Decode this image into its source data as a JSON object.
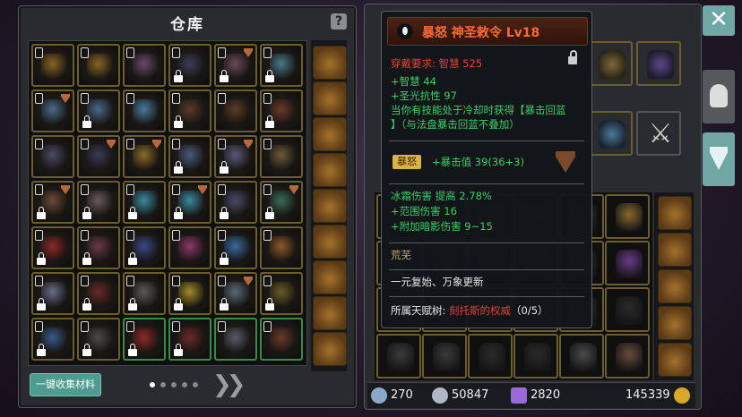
{
  "warehouse": {
    "title": "仓库",
    "help_icon": "question-icon",
    "collect_button": "一键收集材料",
    "page_dots": 5,
    "active_page": 1,
    "next_icon": "double-chevron-right-icon"
  },
  "tooltip": {
    "icon": "ring-icon",
    "title": "暴怒 神圣敕令 Lv18",
    "requirement_label": "穿戴要求:",
    "requirement_value": "智慧 525",
    "stat1": "+智慧 44",
    "stat2": "+圣光抗性 97",
    "effect_line1": "当你有技能处于冷却时获得【暴击回蓝",
    "effect_line2": "】（与法盘暴击回蓝不叠加）",
    "rage_tag": "暴怒",
    "rage_stat": "+暴击值 39(36+3)",
    "bonus1": "冰霜伤害  提高  2.78%",
    "bonus2": "+范围伤害  16",
    "bonus3": "+附加暗影伤害  9~15",
    "set_name": "荒芜",
    "flavor": "一元复始、万象更新",
    "talent_label": "所属天赋树:",
    "talent_value": "刻托斯的权威",
    "talent_progress": "（0/5）"
  },
  "status": {
    "attack": "270",
    "defense": "50847",
    "gems": "2820",
    "gold": "145339"
  },
  "colors": {
    "accent_teal": "#6ea7a4",
    "item_border_gold": "#6b5d2e",
    "item_border_green": "#3d8a48",
    "title_orange": "#ff6a3a",
    "stat_green": "#3ccf6a"
  },
  "grid_items": [
    {
      "art": "#8a6426",
      "badge": false,
      "lock": false,
      "green": false
    },
    {
      "art": "#8a6426",
      "badge": false,
      "lock": false,
      "green": false
    },
    {
      "art": "#6a4a6a",
      "badge": false,
      "lock": false,
      "green": false
    },
    {
      "art": "#3b3d55",
      "badge": false,
      "lock": true,
      "green": false
    },
    {
      "art": "#6a4a5a",
      "badge": true,
      "lock": true,
      "green": false
    },
    {
      "art": "#4a7a8a",
      "badge": false,
      "lock": true,
      "green": false
    },
    {
      "art": "#4a6a8a",
      "badge": true,
      "lock": false,
      "green": false
    },
    {
      "art": "#4a6a8a",
      "badge": false,
      "lock": true,
      "green": false
    },
    {
      "art": "#4a7aa0",
      "badge": false,
      "lock": false,
      "green": false
    },
    {
      "art": "#5a3a2a",
      "badge": false,
      "lock": true,
      "green": false
    },
    {
      "art": "#5a3a2a",
      "badge": false,
      "lock": false,
      "green": false
    },
    {
      "art": "#6a3a2a",
      "badge": false,
      "lock": true,
      "green": false
    },
    {
      "art": "#4a4a66",
      "badge": false,
      "lock": false,
      "green": false
    },
    {
      "art": "#3a3a5a",
      "badge": true,
      "lock": false,
      "green": false
    },
    {
      "art": "#8a6a2a",
      "badge": true,
      "lock": false,
      "green": false
    },
    {
      "art": "#4a5a7a",
      "badge": false,
      "lock": true,
      "green": false
    },
    {
      "art": "#5a5a7a",
      "badge": true,
      "lock": true,
      "green": false
    },
    {
      "art": "#6a5a3a",
      "badge": false,
      "lock": false,
      "green": false
    },
    {
      "art": "#6a4a3a",
      "badge": true,
      "lock": true,
      "green": false
    },
    {
      "art": "#6a5a5a",
      "badge": false,
      "lock": true,
      "green": false
    },
    {
      "art": "#3a8aa0",
      "badge": false,
      "lock": true,
      "green": false
    },
    {
      "art": "#3a8aa0",
      "badge": true,
      "lock": true,
      "green": false
    },
    {
      "art": "#4a4a6a",
      "badge": false,
      "lock": true,
      "green": false
    },
    {
      "art": "#3a6a5a",
      "badge": true,
      "lock": true,
      "green": false
    },
    {
      "art": "#8a2a2a",
      "badge": false,
      "lock": true,
      "green": false
    },
    {
      "art": "#6a3a4a",
      "badge": false,
      "lock": true,
      "green": false
    },
    {
      "art": "#3a4a8a",
      "badge": false,
      "lock": true,
      "green": false
    },
    {
      "art": "#8a3a6a",
      "badge": false,
      "lock": false,
      "green": false
    },
    {
      "art": "#3a6aa0",
      "badge": false,
      "lock": true,
      "green": false
    },
    {
      "art": "#8a5a2a",
      "badge": false,
      "lock": false,
      "green": false
    },
    {
      "art": "#6a6a8a",
      "badge": false,
      "lock": true,
      "green": false
    },
    {
      "art": "#6a2a2a",
      "badge": false,
      "lock": true,
      "green": false
    },
    {
      "art": "#5a5a5a",
      "badge": false,
      "lock": true,
      "green": false
    },
    {
      "art": "#a08a2a",
      "badge": false,
      "lock": true,
      "green": false
    },
    {
      "art": "#5a6a7a",
      "badge": true,
      "lock": true,
      "green": false
    },
    {
      "art": "#6a5a2a",
      "badge": false,
      "lock": true,
      "green": false
    },
    {
      "art": "#3a5a8a",
      "badge": false,
      "lock": true,
      "green": false
    },
    {
      "art": "#4a4a4a",
      "badge": false,
      "lock": true,
      "green": false
    },
    {
      "art": "#8a2a2a",
      "badge": false,
      "lock": true,
      "green": true
    },
    {
      "art": "#6a2a2a",
      "badge": false,
      "lock": true,
      "green": true
    },
    {
      "art": "#5a5a6a",
      "badge": false,
      "lock": false,
      "green": true
    },
    {
      "art": "#6a3a2a",
      "badge": false,
      "lock": false,
      "green": true
    }
  ]
}
